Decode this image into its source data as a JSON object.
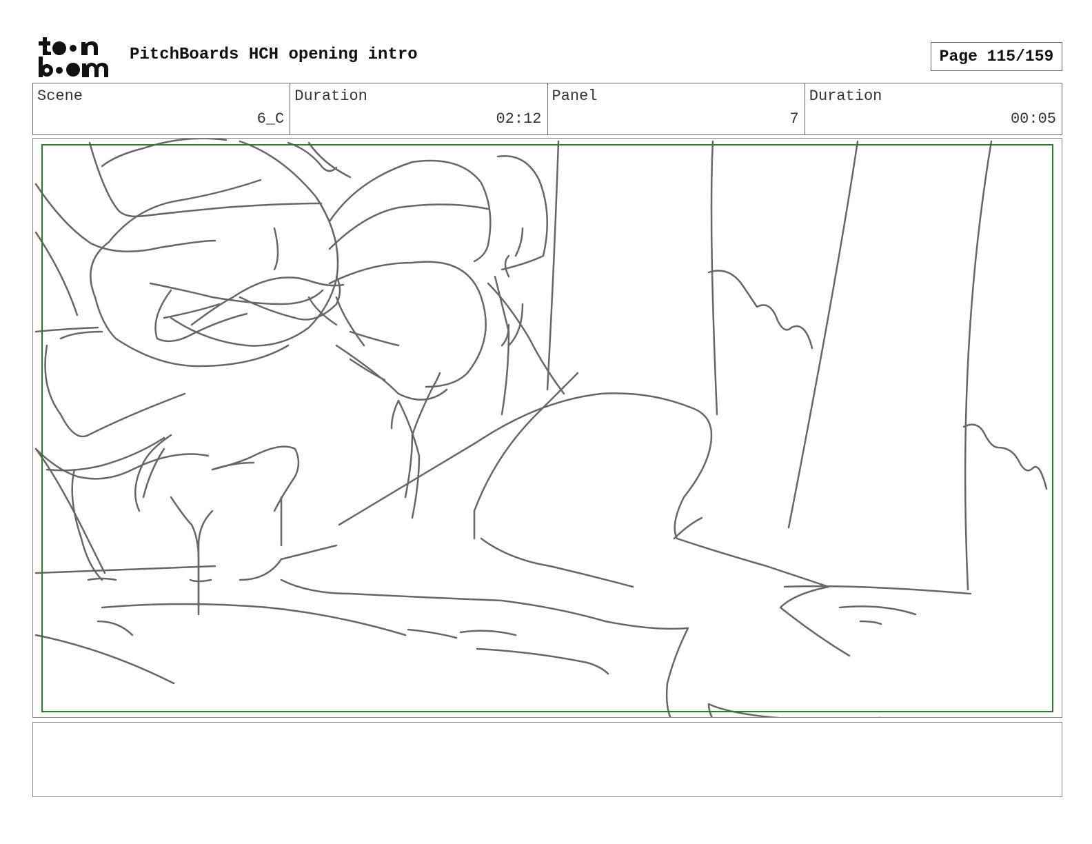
{
  "header": {
    "logo_text": "toon boom",
    "project_title": "PitchBoards HCH opening intro",
    "page_label": "Page 115/159"
  },
  "info": {
    "scene_label": "Scene",
    "scene_value": "6_C",
    "scene_duration_label": "Duration",
    "scene_duration_value": "02:12",
    "panel_label": "Panel",
    "panel_value": "7",
    "panel_duration_label": "Duration",
    "panel_duration_value": "00:05"
  },
  "notes": {
    "text": ""
  },
  "colors": {
    "sketch_stroke": "#666666",
    "safe_frame": "#2d7a2d",
    "border": "#666666"
  }
}
